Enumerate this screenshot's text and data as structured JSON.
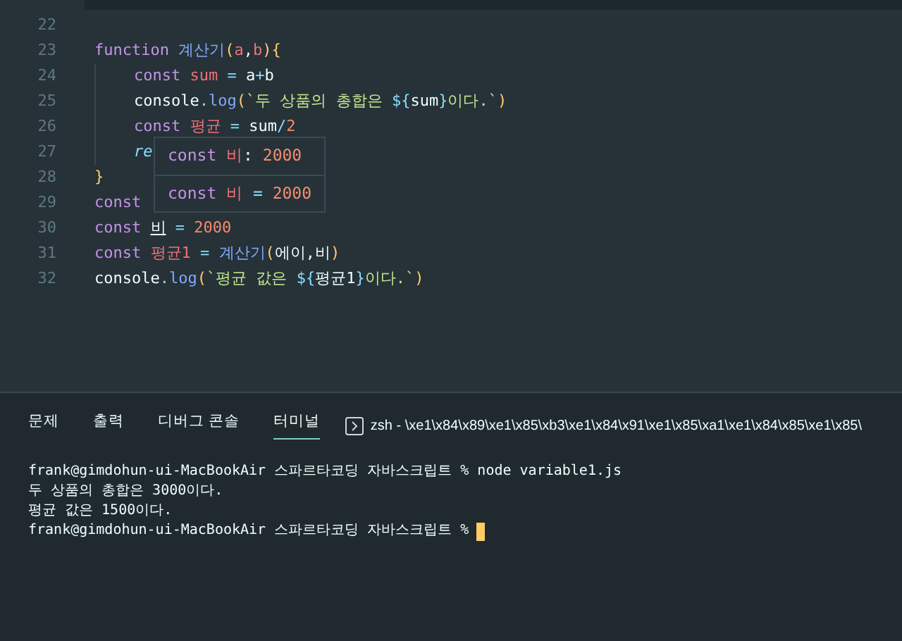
{
  "editor": {
    "lines": [
      {
        "number": "22"
      },
      {
        "number": "23",
        "tokens": [
          {
            "text": "function ",
            "kind": "keyword"
          },
          {
            "text": "계산기",
            "kind": "function"
          },
          {
            "text": "(",
            "kind": "bracket"
          },
          {
            "text": "a",
            "kind": "variable"
          },
          {
            "text": ",",
            "kind": "plain"
          },
          {
            "text": "b",
            "kind": "variable"
          },
          {
            "text": "){",
            "kind": "bracket"
          }
        ],
        "children": [
          {
            "number": "24",
            "tokens": [
              {
                "text": "const ",
                "kind": "keyword"
              },
              {
                "text": "sum",
                "kind": "variable"
              },
              {
                "text": " = ",
                "kind": "operator"
              },
              {
                "text": "a",
                "kind": "plain"
              },
              {
                "text": "+",
                "kind": "operator"
              },
              {
                "text": "b",
                "kind": "plain"
              }
            ]
          },
          {
            "number": "25",
            "tokens": [
              {
                "text": "console",
                "kind": "plain"
              },
              {
                "text": ".",
                "kind": "operator"
              },
              {
                "text": "log",
                "kind": "function"
              },
              {
                "text": "(",
                "kind": "bracket"
              },
              {
                "text": "`두 상품의 총합은 ",
                "kind": "string"
              },
              {
                "text": "${",
                "kind": "operator"
              },
              {
                "text": "sum",
                "kind": "plain"
              },
              {
                "text": "}",
                "kind": "operator"
              },
              {
                "text": "이다.`",
                "kind": "string"
              },
              {
                "text": ")",
                "kind": "bracket"
              }
            ]
          },
          {
            "number": "26",
            "tokens": [
              {
                "text": "const ",
                "kind": "keyword"
              },
              {
                "text": "평균",
                "kind": "variable"
              },
              {
                "text": " = ",
                "kind": "operator"
              },
              {
                "text": "sum",
                "kind": "plain"
              },
              {
                "text": "/",
                "kind": "operator"
              },
              {
                "text": "2",
                "kind": "number"
              }
            ]
          },
          {
            "number": "27",
            "tokens": [
              {
                "text": "re",
                "kind": "return"
              }
            ]
          }
        ]
      },
      {
        "number": "28",
        "tokens": [
          {
            "text": "}",
            "kind": "bracket"
          }
        ]
      },
      {
        "number": "29",
        "tokens": [
          {
            "text": "const",
            "kind": "keyword"
          }
        ]
      },
      {
        "number": "30",
        "tokens": [
          {
            "text": "const ",
            "kind": "keyword"
          },
          {
            "text": "비",
            "kind": "reference"
          },
          {
            "text": " = ",
            "kind": "operator"
          },
          {
            "text": "2000",
            "kind": "number"
          }
        ]
      },
      {
        "number": "31",
        "tokens": [
          {
            "text": "const ",
            "kind": "keyword"
          },
          {
            "text": "평균1",
            "kind": "variable"
          },
          {
            "text": " = ",
            "kind": "operator"
          },
          {
            "text": "계산기",
            "kind": "function"
          },
          {
            "text": "(",
            "kind": "bracket"
          },
          {
            "text": "에이",
            "kind": "plain"
          },
          {
            "text": ",",
            "kind": "plain"
          },
          {
            "text": "비",
            "kind": "plain"
          },
          {
            "text": ")",
            "kind": "bracket"
          }
        ]
      },
      {
        "number": "32",
        "tokens": [
          {
            "text": "console",
            "kind": "plain"
          },
          {
            "text": ".",
            "kind": "operator"
          },
          {
            "text": "log",
            "kind": "function"
          },
          {
            "text": "(",
            "kind": "bracket"
          },
          {
            "text": "`평균 값은 ",
            "kind": "string"
          },
          {
            "text": "${",
            "kind": "operator"
          },
          {
            "text": "평균1",
            "kind": "plain"
          },
          {
            "text": "}",
            "kind": "operator"
          },
          {
            "text": "이다.`",
            "kind": "string"
          },
          {
            "text": ")",
            "kind": "bracket"
          }
        ]
      }
    ]
  },
  "hover": {
    "rows": [
      {
        "tokens": [
          {
            "text": "const ",
            "kind": "keyword"
          },
          {
            "text": "비",
            "kind": "variable"
          },
          {
            "text": ": ",
            "kind": "plain"
          },
          {
            "text": "2000",
            "kind": "number"
          }
        ]
      },
      {
        "tokens": [
          {
            "text": "const ",
            "kind": "keyword"
          },
          {
            "text": "비",
            "kind": "variable"
          },
          {
            "text": " = ",
            "kind": "operator"
          },
          {
            "text": "2000",
            "kind": "number"
          }
        ]
      }
    ]
  },
  "panel": {
    "tabs": [
      {
        "label": "문제",
        "selected": false
      },
      {
        "label": "출력",
        "selected": false
      },
      {
        "label": "디버그 콘솔",
        "selected": false
      },
      {
        "label": "터미널",
        "selected": true
      }
    ],
    "shell": "zsh - \\xe1\\x84\\x89\\xe1\\x85\\xb3\\xe1\\x84\\x91\\xe1\\x85\\xa1\\xe1\\x84\\x85\\xe1\\x85\\",
    "terminal": [
      {
        "text": "frank@gimdohun-ui-MacBookAir 스파르타코딩 자바스크립트 % node variable1.js",
        "cursor": false
      },
      {
        "text": "두 상품의 총합은 3000이다.",
        "cursor": false
      },
      {
        "text": "평균 값은 1500이다.",
        "cursor": false
      },
      {
        "text": "frank@gimdohun-ui-MacBookAir 스파르타코딩 자바스크립트 %",
        "cursor": true
      }
    ]
  }
}
